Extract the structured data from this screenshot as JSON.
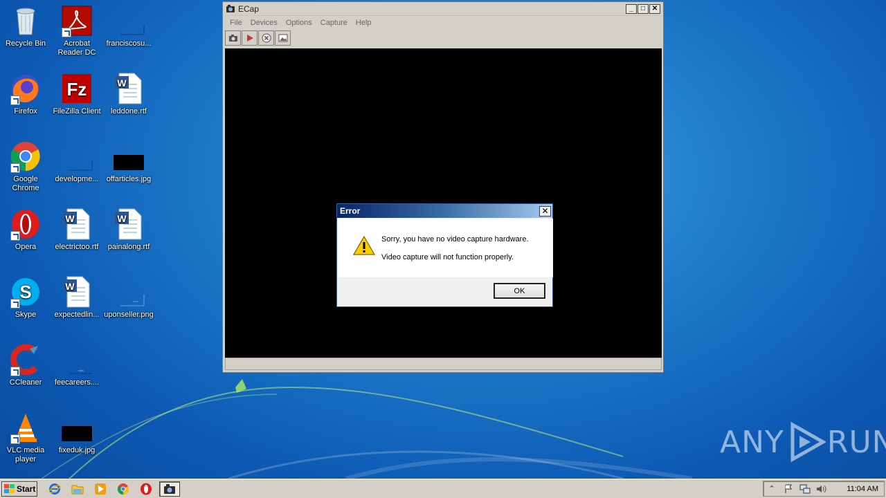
{
  "desktop": {
    "icons": [
      {
        "label": "Recycle Bin",
        "icon": "recycle-bin-icon"
      },
      {
        "label": "Acrobat Reader DC",
        "icon": "acrobat-icon"
      },
      {
        "label": "franciscosu...",
        "icon": "blank-file-icon"
      },
      {
        "label": "Firefox",
        "icon": "firefox-icon"
      },
      {
        "label": "FileZilla Client",
        "icon": "filezilla-icon"
      },
      {
        "label": "leddone.rtf",
        "icon": "word-doc-icon"
      },
      {
        "label": "Google Chrome",
        "icon": "chrome-icon"
      },
      {
        "label": "developme...",
        "icon": "blank-file-icon"
      },
      {
        "label": "offarticles.jpg",
        "icon": "image-black-icon"
      },
      {
        "label": "Opera",
        "icon": "opera-icon"
      },
      {
        "label": "electrictoo.rtf",
        "icon": "word-doc-icon"
      },
      {
        "label": "painalong.rtf",
        "icon": "word-doc-icon"
      },
      {
        "label": "Skype",
        "icon": "skype-icon"
      },
      {
        "label": "expectedlin...",
        "icon": "word-doc-icon"
      },
      {
        "label": "uponseller.png",
        "icon": "blank-file-icon"
      },
      {
        "label": "CCleaner",
        "icon": "ccleaner-icon"
      },
      {
        "label": "feecareers....",
        "icon": "blank-file-icon"
      },
      {
        "label": "VLC media player",
        "icon": "vlc-icon"
      },
      {
        "label": "fixeduk.jpg",
        "icon": "image-black-icon"
      }
    ]
  },
  "ecap": {
    "title": "ECap",
    "menu": [
      "File",
      "Devices",
      "Options",
      "Capture",
      "Help"
    ],
    "toolbar": [
      "camera-icon",
      "play-icon",
      "stop-icon",
      "image-icon"
    ]
  },
  "error_dialog": {
    "title": "Error",
    "message_line1": "Sorry, you have no video capture hardware.",
    "message_line2": "Video capture will not function properly.",
    "ok_label": "OK",
    "icon": "warning-icon"
  },
  "watermark": {
    "left": "ANY",
    "right": "RUN"
  },
  "taskbar": {
    "start_label": "Start",
    "quick_launch": [
      "ie-icon",
      "explorer-icon",
      "media-player-icon",
      "chrome-icon",
      "opera-icon"
    ],
    "active_task_icon": "ecap-icon",
    "tray_icons": [
      "chevron-up-icon",
      "flag-icon",
      "network-icon",
      "volume-icon"
    ],
    "clock": "11:04 AM"
  }
}
